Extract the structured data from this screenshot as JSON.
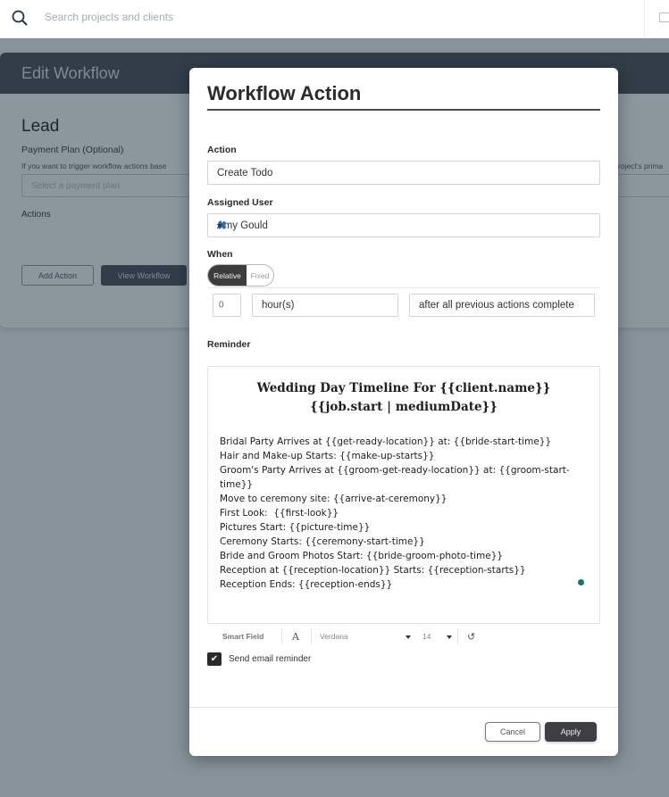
{
  "topbar": {
    "search_placeholder": "Search projects and clients",
    "icons": {
      "search": "search-icon",
      "mail": "mail-icon"
    }
  },
  "background": {
    "card_title": "Edit Workflow",
    "section_title": "Lead",
    "payment_plan_label": "Payment Plan (Optional)",
    "payment_plan_hint_left": "If you want to trigger workflow actions base",
    "payment_plan_hint_right": "roject's prima",
    "payment_plan_placeholder": "Select a payment plan",
    "actions_label": "Actions",
    "add_action_button": "Add Action",
    "view_workflow_button": "View Workflow"
  },
  "modal": {
    "title": "Workflow Action",
    "action": {
      "label": "Action",
      "value": "Create Todo"
    },
    "assigned_user": {
      "label": "Assigned User",
      "value": "Amy Gould",
      "clear_glyph": "✖"
    },
    "when": {
      "label": "When",
      "toggle_options": [
        "Relative",
        "Fixed"
      ],
      "selected": "Relative",
      "amount": "0",
      "unit": "hour(s)",
      "relation": "after all previous actions complete"
    },
    "reminder": {
      "label": "Reminder",
      "title_line1": "Wedding Day Timeline For {{client.name}}",
      "title_line2": "{{job.start | mediumDate}}",
      "lines": [
        "Bridal Party Arrives at {{get-ready-location}} at: {{bride-start-time}}",
        "Hair and Make-up Starts: {{make-up-starts}}",
        "Groom's Party Arrives at {{groom-get-ready-location}} at: {{groom-start-time}}",
        "Move to ceremony site: {{arrive-at-ceremony}}",
        "First Look:  {{first-look}}",
        "Pictures Start: {{picture-time}}",
        "Ceremony Starts: {{ceremony-start-time}}",
        "Bride and Groom Photos Start: {{bride-groom-photo-time}}",
        "Reception at {{reception-location}} Starts: {{reception-starts}}",
        "Reception Ends: {{reception-ends}}"
      ],
      "status_dot_color": "#0f7a68"
    },
    "toolbar": {
      "smart_field": "Smart Field",
      "font_glyph": "A",
      "font_family": "Verdana",
      "font_size": "14",
      "undo_glyph": "↺"
    },
    "send_email_reminder": {
      "label": "Send email reminder",
      "checked": true,
      "check_glyph": "✔"
    },
    "cancel_button": "Cancel",
    "apply_button": "Apply"
  }
}
